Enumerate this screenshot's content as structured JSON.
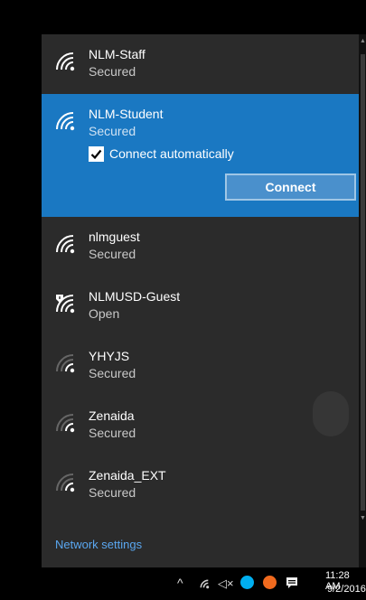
{
  "networks": [
    {
      "name": "NLM-Staff",
      "status": "Secured"
    },
    {
      "name": "NLM-Student",
      "status": "Secured",
      "selected": true,
      "connect_auto_label": "Connect automatically",
      "connect_auto_checked": true,
      "connect_label": "Connect"
    },
    {
      "name": "nlmguest",
      "status": "Secured"
    },
    {
      "name": "NLMUSD-Guest",
      "status": "Open",
      "icon": "wifi-shield-icon"
    },
    {
      "name": "YHYJS",
      "status": "Secured",
      "weak": true
    },
    {
      "name": "Zenaida",
      "status": "Secured",
      "weak": true
    },
    {
      "name": "Zenaida_EXT",
      "status": "Secured",
      "weak": true
    }
  ],
  "footer": {
    "network_settings": "Network settings"
  },
  "taskbar": {
    "icons": [
      "chevron-up-icon",
      "wifi-icon",
      "speaker-muted-icon",
      "skype-icon",
      "security-icon",
      "notification-icon"
    ],
    "time": "11:28 AM",
    "date": "9/2/2016"
  },
  "colors": {
    "flyout_bg": "#2b2b2b",
    "selected_bg": "#1a78c2",
    "link": "#5aa7f0"
  }
}
